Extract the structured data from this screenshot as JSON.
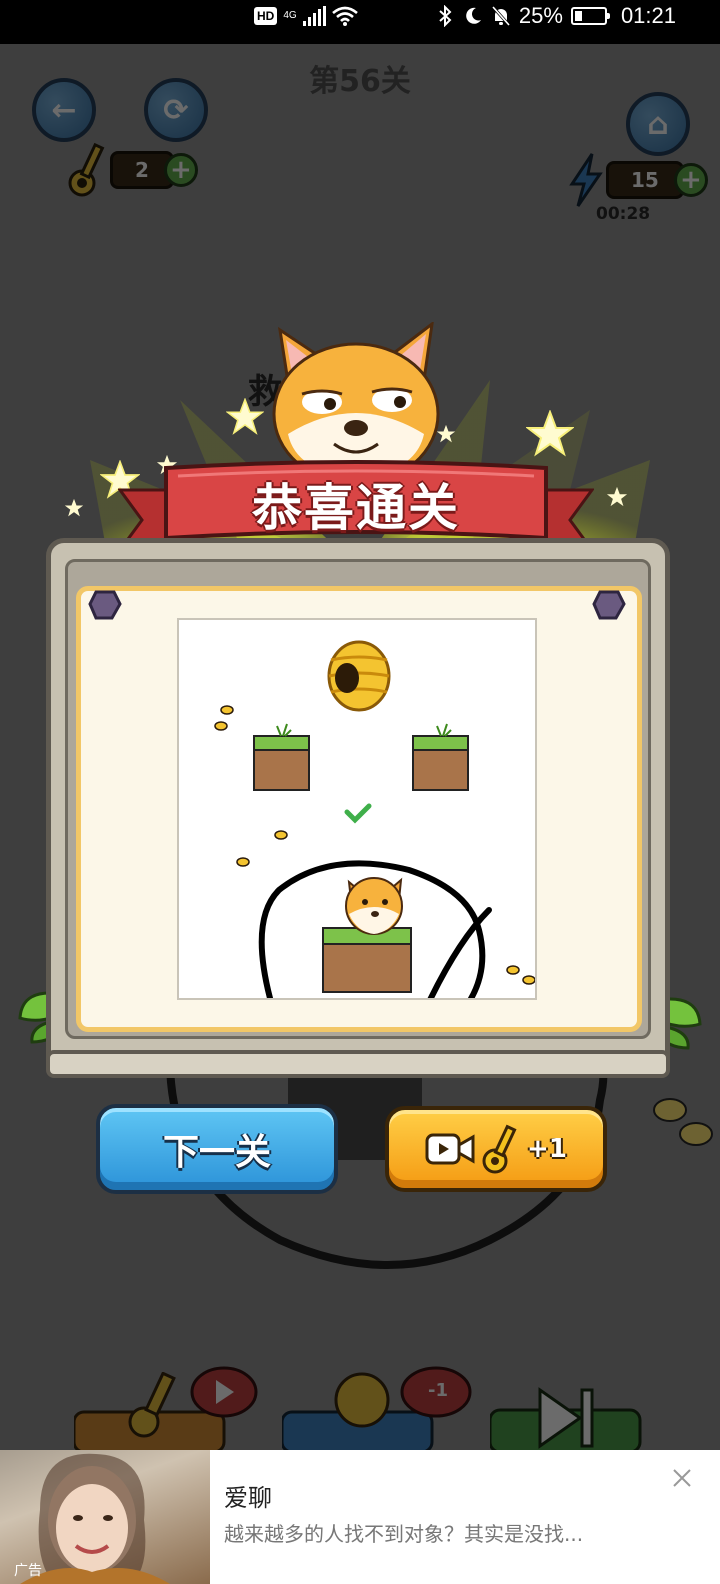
{
  "status_bar": {
    "hd": "HD",
    "network": "4G",
    "battery": "25%",
    "battery_level": 0.25,
    "time": "01:21"
  },
  "header": {
    "level_title": "第56关",
    "keys_count": "2",
    "energy_count": "15",
    "timer": "00:28"
  },
  "celebration": {
    "banner_text": "恭喜通关",
    "hidden_title_fragment": "救"
  },
  "actions": {
    "next_label": "下一关",
    "reward_label": "+1"
  },
  "tools": {
    "hint_cost": "-1"
  },
  "ad": {
    "title": "爱聊",
    "description": "越来越多的人找不到对象？其实是没找...",
    "label": "广告"
  },
  "colors": {
    "ribbon_red": "#d94545",
    "next_blue": "#3aa6e6",
    "reward_orange": "#f7ad1f",
    "parchment": "#fcf7e8"
  }
}
